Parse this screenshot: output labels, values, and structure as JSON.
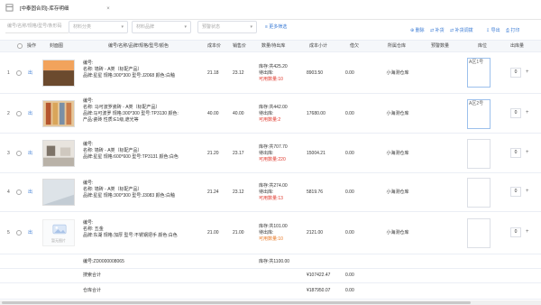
{
  "topbar": {
    "title": "[中泰固合同]-库存明细",
    "close_glyph": "×",
    "colors": {
      "accent": "#3a7bd5",
      "danger": "#e0372b",
      "warning": "#e87722"
    }
  },
  "filters": {
    "search_placeholder": "编号/名称/规格/型号/条形码",
    "category_placeholder": "材料分类",
    "brand_placeholder": "材料品牌",
    "warning_placeholder": "预警状态",
    "more_label": "≡ 更多筛选"
  },
  "actions": {
    "delete": "删除",
    "split": "补货",
    "warehouse_set": "补货调拨",
    "export": "导出",
    "print": "打印"
  },
  "table": {
    "headers": {
      "op": "操作",
      "image": "封面图",
      "info": "编号/名称/品牌/规格/型号/颜色",
      "cost": "成本价",
      "sale": "销售价",
      "stock": "数量/待出库",
      "cost_total": "成本小计",
      "loan": "借欠",
      "warehouse": "所属仓库",
      "warn_qty": "预警数量",
      "location": "库位",
      "issue_qty": "出库量"
    },
    "rows": [
      {
        "idx": "1",
        "op": "出",
        "lines": [
          "编号:",
          "名称: 墙砖 - A类（标配产品）",
          "品牌:星星    规格:300*300    型号:J2068    颜色:白釉"
        ],
        "cost": "21.18",
        "sale": "23.12",
        "stock": [
          "库存:共425.20",
          "待出库:",
          "可用数量:10"
        ],
        "cost_total": "8903.50",
        "loan": "0.00",
        "warehouse": "小海测仓库",
        "location": "A区1号",
        "qty": "0"
      },
      {
        "idx": "2",
        "op": "出",
        "lines": [
          "编号:",
          "名称: 马可波罗瓷砖 - A类（标配产品）",
          "品牌:马可波罗    规格:300*300    型号:TP3130    颜色:",
          "产品:瓷砖    性质:E1级,遮光等"
        ],
        "cost": "40.00",
        "sale": "40.00",
        "stock": [
          "库存:共442.00",
          "待出库:",
          "可用数量:2"
        ],
        "cost_total": "17680.00",
        "loan": "0.00",
        "warehouse": "小海测仓库",
        "location": "A区2号",
        "qty": "0"
      },
      {
        "idx": "3",
        "op": "出",
        "lines": [
          "编号:",
          "名称: 墙砖 - A类（标配产品）",
          "品牌:星星    规格:600*600    型号:TP3131    颜色:白色"
        ],
        "cost": "21.20",
        "sale": "23.17",
        "stock": [
          "库存:共707.70",
          "待出库:",
          "可用数量:220"
        ],
        "cost_total": "15004.21",
        "loan": "0.00",
        "warehouse": "小海测仓库",
        "location": "",
        "qty": "0"
      },
      {
        "idx": "4",
        "op": "出",
        "lines": [
          "编号:",
          "名称: 墙砖 - A类（标配产品）",
          "品牌:星星    规格:300*300    型号:J3083    颜色:白釉"
        ],
        "cost": "21.24",
        "sale": "23.12",
        "stock": [
          "库存:共274.00",
          "待出库:",
          "可用数量:13"
        ],
        "cost_total": "5819.76",
        "loan": "0.00",
        "warehouse": "小海测仓库",
        "location": "",
        "qty": "0"
      },
      {
        "idx": "5",
        "op": "出",
        "lines": [
          "编号:",
          "名称: 五金",
          "品牌:东湖    规格:加厚    型号:不锈钢把手    颜色:白色"
        ],
        "cost": "21.00",
        "sale": "21.00",
        "stock": [
          "库存:共101.00",
          "待出库:",
          "可用数量:10"
        ],
        "cost_total": "2121.00",
        "loan": "0.00",
        "warehouse": "小海测仓库",
        "location": "",
        "qty": "0"
      },
      {
        "idx": "",
        "op": "",
        "lines": [
          "编号:ZD0000008065"
        ],
        "cost": "",
        "sale": "",
        "stock": [
          "库存:共1100.00"
        ],
        "cost_total": "",
        "loan": "",
        "warehouse": "",
        "location": "",
        "qty": ""
      }
    ],
    "summary": [
      {
        "label": "搜索合计",
        "cost_total": "¥107422.47",
        "loan": "0.00"
      },
      {
        "label": "仓库合计",
        "cost_total": "¥187950.07",
        "loan": "0.00"
      }
    ],
    "no_image_label": "暂无图片"
  }
}
